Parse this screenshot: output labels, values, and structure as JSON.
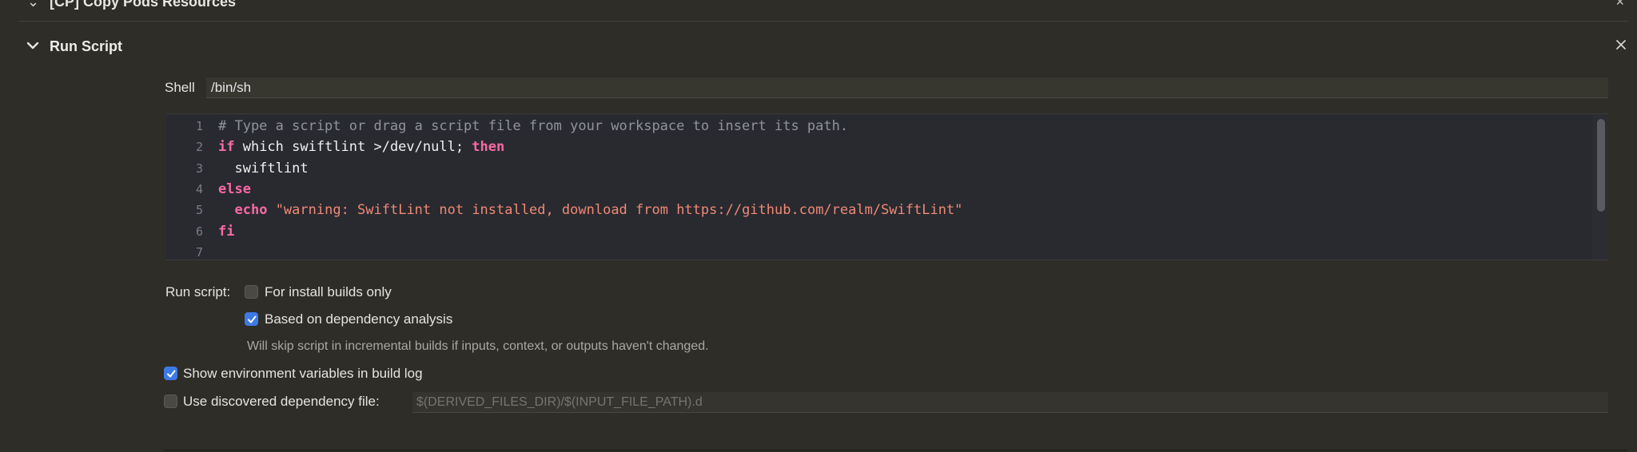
{
  "previous_phase": {
    "title": "[CP] Copy Pods Resources"
  },
  "phase": {
    "title": "Run Script"
  },
  "shell": {
    "label": "Shell",
    "value": "/bin/sh"
  },
  "editor": {
    "line_numbers": [
      "1",
      "2",
      "3",
      "4",
      "5",
      "6",
      "7"
    ],
    "lines": [
      {
        "segments": [
          {
            "t": "# Type a script or drag a script file from your workspace to insert its path.",
            "c": "comment"
          }
        ]
      },
      {
        "segments": [
          {
            "t": "if",
            "c": "kw"
          },
          {
            "t": " which swiftlint >/dev/null; ",
            "c": "plain"
          },
          {
            "t": "then",
            "c": "kw"
          }
        ]
      },
      {
        "segments": [
          {
            "t": "  swiftlint",
            "c": "plain"
          }
        ]
      },
      {
        "segments": [
          {
            "t": "else",
            "c": "kw"
          }
        ]
      },
      {
        "segments": [
          {
            "t": "  ",
            "c": "plain"
          },
          {
            "t": "echo",
            "c": "kw"
          },
          {
            "t": " ",
            "c": "plain"
          },
          {
            "t": "\"warning: SwiftLint not installed, download from https://github.com/realm/SwiftLint\"",
            "c": "str"
          }
        ]
      },
      {
        "segments": [
          {
            "t": "fi",
            "c": "kw"
          }
        ]
      },
      {
        "segments": []
      }
    ]
  },
  "run_script": {
    "label": "Run script:",
    "install_builds_only": {
      "label": "For install builds only",
      "checked": false
    },
    "dependency_analysis": {
      "label": "Based on dependency analysis",
      "checked": true
    },
    "dependency_hint": "Will skip script in incremental builds if inputs, context, or outputs haven't changed."
  },
  "show_env_vars": {
    "label": "Show environment variables in build log",
    "checked": true
  },
  "discovered_dependency": {
    "label": "Use discovered dependency file:",
    "checked": false,
    "placeholder": "$(DERIVED_FILES_DIR)/$(INPUT_FILE_PATH).d"
  },
  "colors": {
    "background": "#2e2d28",
    "editor_bg": "#292a30",
    "keyword": "#f76aa5",
    "string": "#f08975",
    "comment": "#8f949c",
    "checkbox_on": "#3d7ae6"
  },
  "icons": {
    "collapse": "chevron-down-icon",
    "close": "close-icon",
    "check": "checkmark-icon"
  }
}
